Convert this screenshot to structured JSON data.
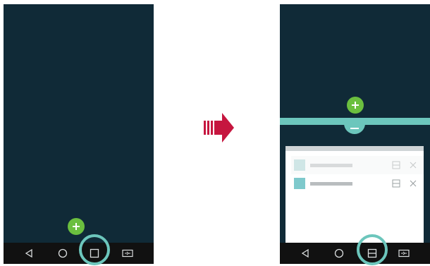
{
  "colors": {
    "screen": "#102a37",
    "nav": "#111111",
    "accent_teal": "#6cc6bc",
    "fab_green": "#6bbf3f",
    "arrow_red": "#c6163f",
    "thumb_teal": "#7ec9cc",
    "icon_gray": "#b4b9bb"
  },
  "left_phone": {
    "nav_buttons": [
      "back-icon",
      "home-icon",
      "overview-icon",
      "dual-window-icon"
    ],
    "highlighted": "overview-icon",
    "fab": "plus-icon"
  },
  "arrow": {
    "icon": "arrow-right-icon"
  },
  "right_phone": {
    "nav_buttons": [
      "back-icon",
      "home-icon",
      "split-screen-icon",
      "dual-window-icon"
    ],
    "highlighted": "split-screen-icon",
    "fab": "plus-icon",
    "divider_handle": "minus-icon",
    "recent_items": [
      {
        "thumb_color": "#a9d2d3",
        "state": "dimmed"
      },
      {
        "thumb_color": "#7ec9cc",
        "state": "normal"
      }
    ]
  }
}
